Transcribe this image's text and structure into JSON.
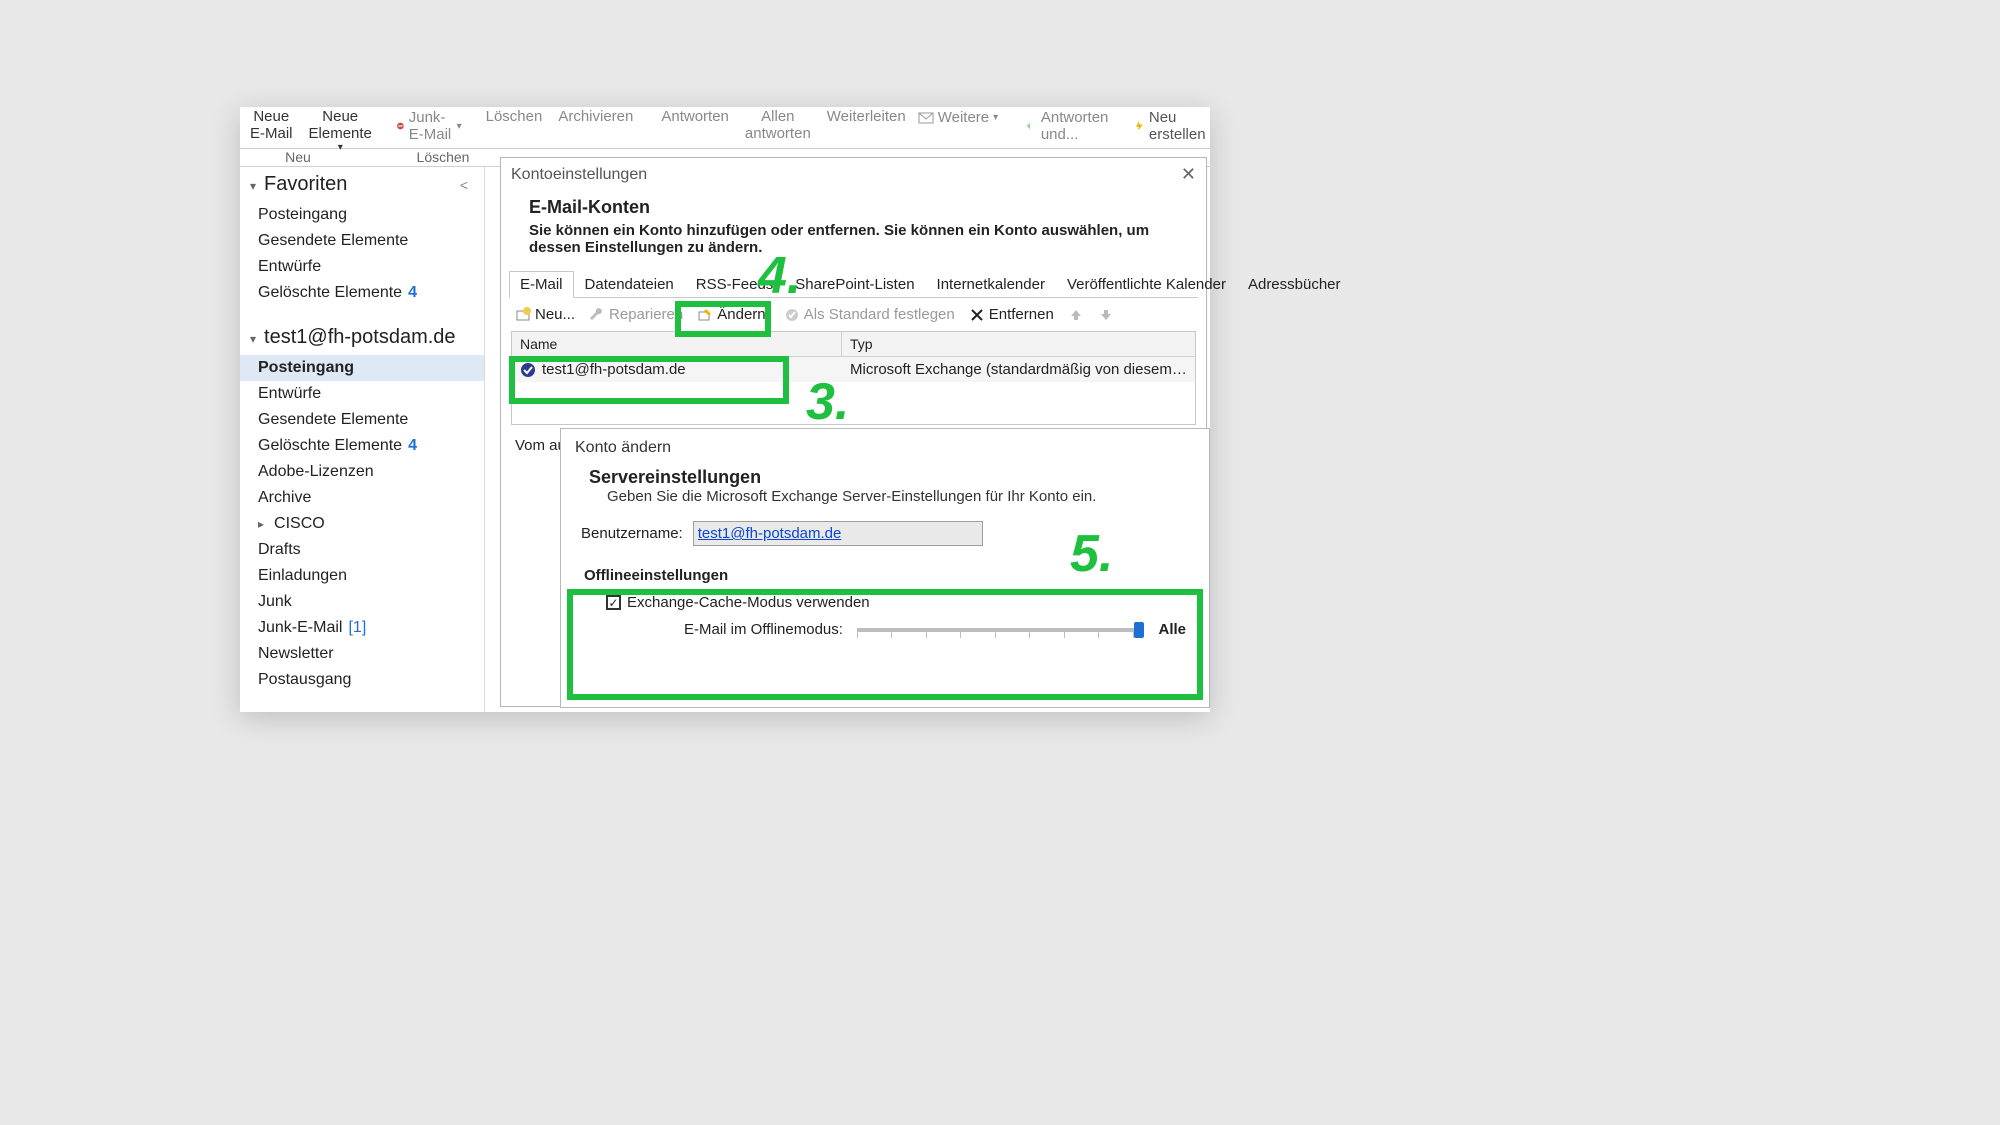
{
  "ribbon": {
    "new_mail": "Neue\nE-Mail",
    "new_items": "Neue\nElemente",
    "junk": "Junk-E-Mail",
    "delete": "Löschen",
    "archive": "Archivieren",
    "reply": "Antworten",
    "reply_all": "Allen\nantworten",
    "forward": "Weiterleiten",
    "more": "Weitere",
    "reply_and": "Antworten und...",
    "new_create": "Neu erstellen",
    "group_new": "Neu",
    "group_delete": "Löschen"
  },
  "sidebar": {
    "favorites_title": "Favoriten",
    "favorites": [
      {
        "label": "Posteingang"
      },
      {
        "label": "Gesendete Elemente"
      },
      {
        "label": "Entwürfe"
      },
      {
        "label": "Gelöschte Elemente",
        "count": "4"
      }
    ],
    "account_title": "test1@fh-potsdam.de",
    "items": [
      {
        "label": "Posteingang",
        "selected": true
      },
      {
        "label": "Entwürfe"
      },
      {
        "label": "Gesendete Elemente"
      },
      {
        "label": "Gelöschte Elemente",
        "count": "4"
      },
      {
        "label": "Adobe-Lizenzen"
      },
      {
        "label": "Archive"
      },
      {
        "label": "CISCO",
        "caret": true
      },
      {
        "label": "Drafts"
      },
      {
        "label": "Einladungen"
      },
      {
        "label": "Junk"
      },
      {
        "label": "Junk-E-Mail",
        "bracket": "[1]"
      },
      {
        "label": "Newsletter"
      },
      {
        "label": "Postausgang"
      }
    ]
  },
  "kdlg": {
    "title": "Kontoeinstellungen",
    "heading": "E-Mail-Konten",
    "desc": "Sie können ein Konto hinzufügen oder entfernen. Sie können ein Konto auswählen, um dessen Einstellungen zu ändern.",
    "tabs": [
      "E-Mail",
      "Datendateien",
      "RSS-Feeds",
      "SharePoint-Listen",
      "Internetkalender",
      "Veröffentlichte Kalender",
      "Adressbücher"
    ],
    "toolbar": {
      "new": "Neu...",
      "repair": "Reparieren",
      "change": "Ändern.",
      "default": "Als Standard festlegen",
      "remove": "Entfernen"
    },
    "headers": {
      "name": "Name",
      "type": "Typ"
    },
    "row": {
      "name": "test1@fh-potsdam.de",
      "type": "Microsoft Exchange (standardmäßig von diesem Kon..."
    },
    "vom": "Vom au"
  },
  "cdlg": {
    "title": "Konto ändern",
    "heading": "Servereinstellungen",
    "desc": "Geben Sie die Microsoft Exchange Server-Einstellungen für Ihr Konto ein.",
    "user_label": "Benutzername:",
    "user_value": "test1@fh-potsdam.de",
    "offline_heading": "Offlineeinstellungen",
    "cache_label": "Exchange-Cache-Modus verwenden",
    "slider_label": "E-Mail im Offlinemodus:",
    "slider_value": "Alle"
  },
  "annotations": {
    "step3": "3.",
    "step4": "4.",
    "step5": "5."
  }
}
